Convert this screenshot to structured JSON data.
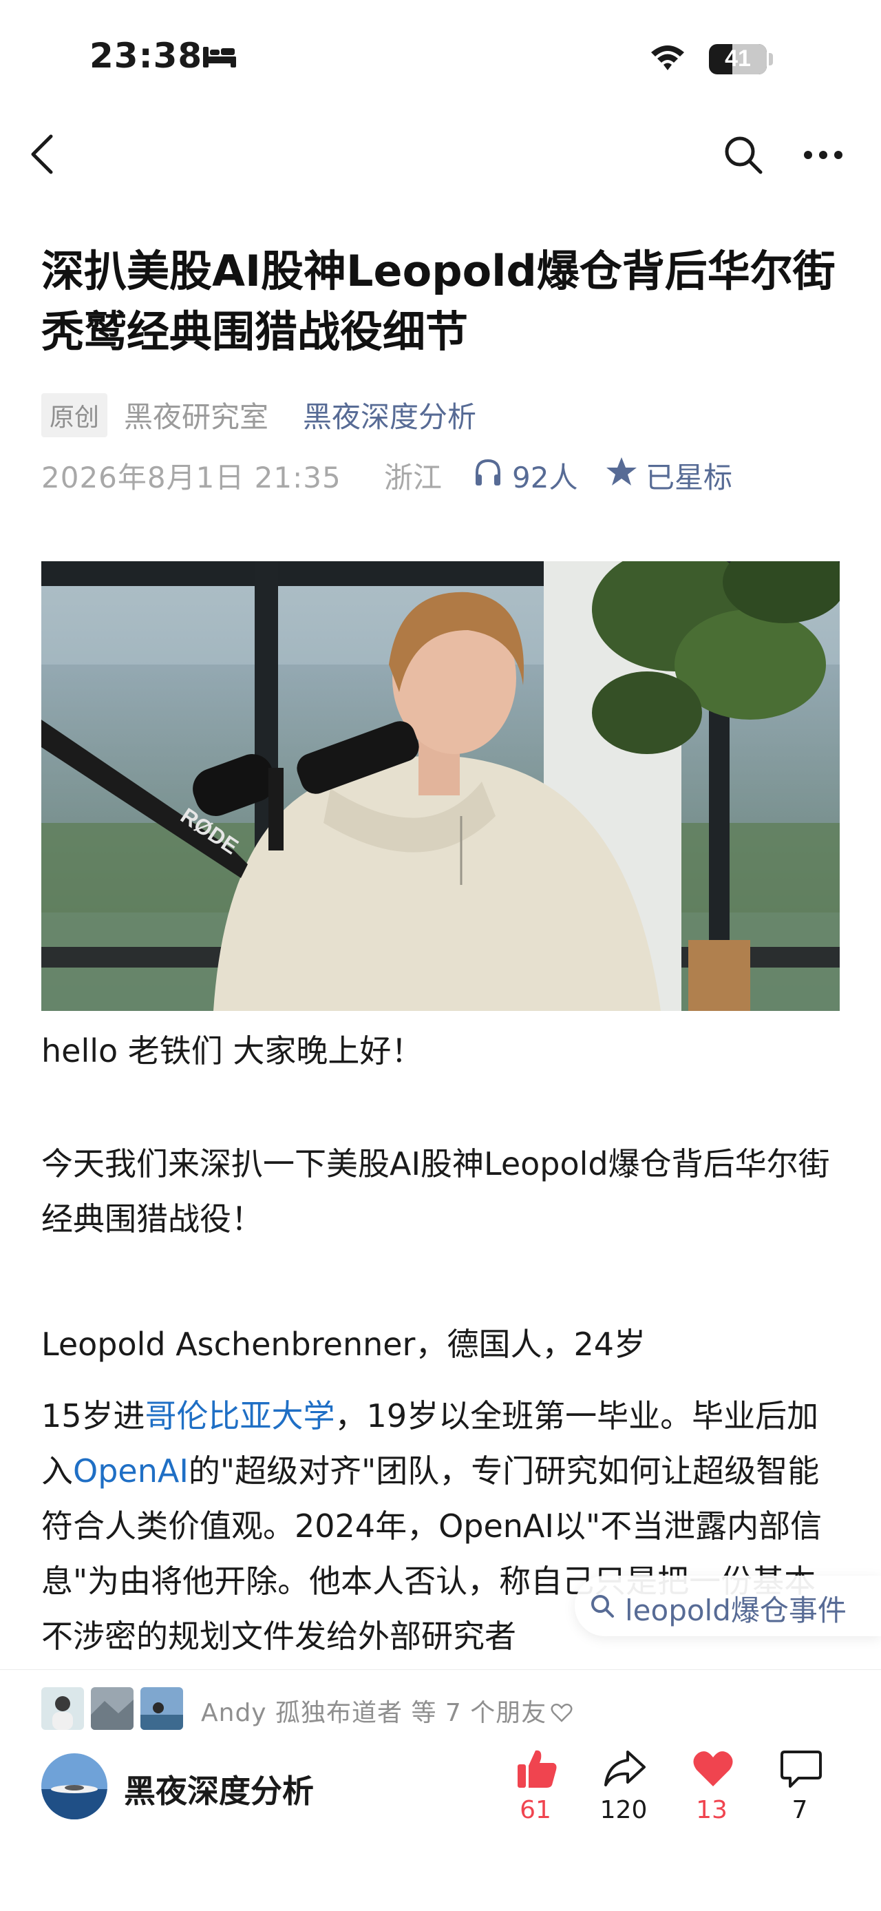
{
  "status_bar": {
    "time": "23:38",
    "battery_level": "41",
    "icons": [
      "bed-icon",
      "wifi-icon",
      "battery-icon"
    ]
  },
  "nav": {
    "icons": [
      "back-icon",
      "search-icon",
      "more-icon"
    ]
  },
  "article": {
    "title": "深扒美股AI股神Leopold爆仓背后华尔街秃鹫经典围猎战役细节",
    "original_badge": "原创",
    "author": "黑夜研究室",
    "account": "黑夜深度分析",
    "date": "2026年8月1日 21:35",
    "location": "浙江",
    "listeners": "92人",
    "star_label": "已星标",
    "paragraphs": {
      "p1": "hello  老铁们  大家晚上好！",
      "p2": "今天我们来深扒一下美股AI股神Leopold爆仓背后华尔街经典围猎战役！",
      "p3": "Leopold Aschenbrenner，德国人，24岁",
      "p4": {
        "t1": "15岁进",
        "link1": "哥伦比亚大学",
        "t2": "，19岁以全班第一毕业。毕业后加入",
        "link2": "OpenAI",
        "t3": "的\"超级对齐\"团队，专门研究如何让超级智能符合人类价值观。2024年，OpenAI以\"不当泄露内部信息\"为由将他开除。他本人否认，称自己只是把一份基本不涉密的规划文件发给外部研究者"
      }
    }
  },
  "search_chip": {
    "label": "leopold爆仓事件"
  },
  "footer": {
    "friends_text": "Andy 孤独布道者 等 7 个朋友",
    "account_name": "黑夜深度分析",
    "actions": {
      "like": "61",
      "share": "120",
      "heart": "13",
      "comment": "7"
    },
    "colors": {
      "like": "#f0444f",
      "heart": "#f0444f",
      "link": "#576b95"
    }
  }
}
